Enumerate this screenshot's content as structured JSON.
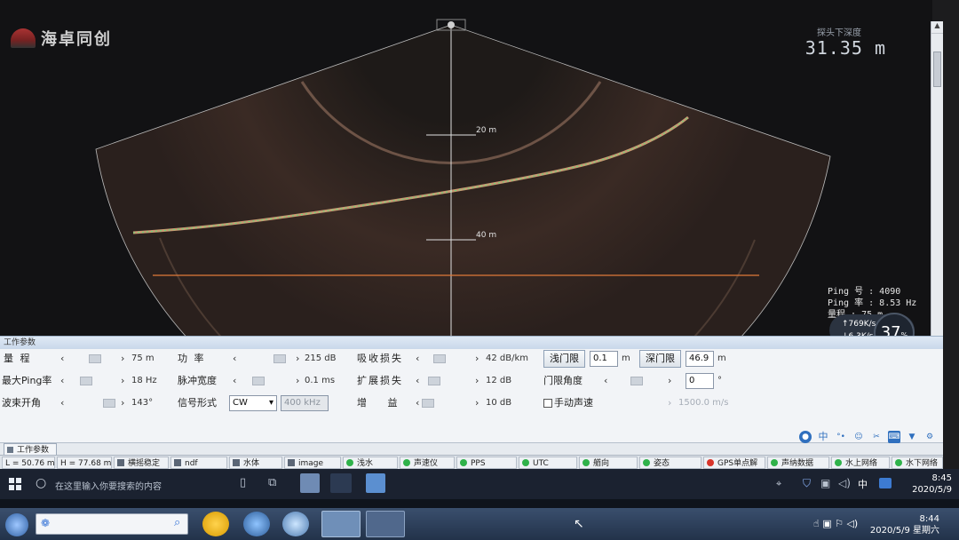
{
  "app": {
    "logo_text": "海卓同创",
    "depth_label": "探头下深度",
    "depth_value": "31.35 m"
  },
  "sonar": {
    "range_marks": [
      "20 m",
      "40 m"
    ]
  },
  "ping": {
    "ping_no_label": "Ping 号",
    "ping_no": "4090",
    "ping_rate_label": "Ping 率",
    "ping_rate": "8.53 Hz",
    "range_label": "量程",
    "range": "75 m"
  },
  "network": {
    "up": "769",
    "down": "6.3",
    "unit": "K/s",
    "percent": "37",
    "percent_unit": "%"
  },
  "panel": {
    "title": "工作参数",
    "row1": {
      "range_label": "量 程",
      "range_value": "75 m",
      "power_label": "功 率",
      "power_value": "215 dB",
      "absorb_label": "吸收损失",
      "absorb_value": "42 dB/km",
      "shallow_gate_btn": "浅门限",
      "shallow_gate_value": "0.1",
      "shallow_gate_unit": "m",
      "deep_gate_btn": "深门限",
      "deep_gate_value": "46.9",
      "deep_gate_unit": "m"
    },
    "row2": {
      "ping_rate_label": "最大Ping率",
      "ping_rate_value": "18 Hz",
      "pulse_label": "脉冲宽度",
      "pulse_value": "0.1 ms",
      "spread_label": "扩展损失",
      "spread_value": "12 dB",
      "gate_angle_label": "门限角度",
      "gate_angle_value": "0",
      "gate_angle_unit": "°"
    },
    "row3": {
      "beam_label": "波束开角",
      "beam_value": "143°",
      "signal_label": "信号形式",
      "signal_select": "CW",
      "freq_select": "400 kHz",
      "gain_label": "增 益",
      "gain_value": "10 dB",
      "manual_sound_label": "手动声速",
      "sound_speed_value": "1500.0 m/s"
    }
  },
  "tab": {
    "label": "工作参数"
  },
  "toolbar_icons": [
    "user-icon",
    "中",
    "dots-icon",
    "smile-icon",
    "mic-icon",
    "keyboard-icon",
    "shirt-icon",
    "gear-icon"
  ],
  "status": {
    "L": "L = 50.76 m",
    "H": "H = 77.68 m",
    "items": [
      {
        "label": "横摇稳定",
        "kind": "box"
      },
      {
        "label": "ndf",
        "kind": "box"
      },
      {
        "label": "水体",
        "kind": "box"
      },
      {
        "label": "image",
        "kind": "box"
      },
      {
        "label": "浅水",
        "kind": "green"
      },
      {
        "label": "声速仪",
        "kind": "green"
      },
      {
        "label": "PPS",
        "kind": "green"
      },
      {
        "label": "UTC",
        "kind": "green"
      },
      {
        "label": "艏向",
        "kind": "green"
      },
      {
        "label": "姿态",
        "kind": "green"
      },
      {
        "label": "GPS单点解",
        "kind": "red"
      },
      {
        "label": "声纳数据",
        "kind": "green"
      },
      {
        "label": "水上网络",
        "kind": "green"
      },
      {
        "label": "水下网络",
        "kind": "green"
      }
    ],
    "colors": {
      "green": "#2fb24a",
      "red": "#d8352b",
      "box": "#5b6676"
    }
  },
  "taskbar1": {
    "search_placeholder": "在这里输入你要搜索的内容",
    "ime": "中",
    "time": "8:45",
    "date": "2020/5/9"
  },
  "taskbar2": {
    "time": "8:44",
    "date": "2020/5/9 星期六"
  }
}
